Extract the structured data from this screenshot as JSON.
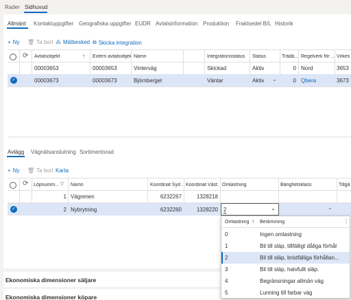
{
  "top_tabs": [
    "Rader",
    "Sidhuvud"
  ],
  "sub_tabs": [
    "Allmänt",
    "Kontaktuppgifter",
    "Geografiska uppgifter",
    "EUDR",
    "Avtalsinformation",
    "Produktion",
    "Fraktsedel B/L",
    "Historik"
  ],
  "toolbar1": {
    "new": "Ny",
    "delete": "Ta bort",
    "measure": "Mätbesked",
    "send": "Skicka integration"
  },
  "grid1": {
    "headers": [
      "Avtalsobjekt",
      "Extern avtalsobjek...",
      "Namn",
      "Integrationsstatus",
      "Status",
      "Trädä...",
      "Regelverk för ...",
      "Virkes"
    ],
    "rows": [
      {
        "obj": "00003653",
        "ext": "00003653",
        "name": "Vinterväg",
        "integ": "Skickad",
        "status": "Aktiv",
        "trad": "0",
        "regel": "Nord",
        "virkes": "3653"
      },
      {
        "obj": "00003673",
        "ext": "00003673",
        "name": "Björnberget",
        "integ": "Väntar",
        "status": "Aktiv",
        "trad": "0",
        "regel": "Qbera",
        "virkes": "3673"
      }
    ]
  },
  "bottom_tabs": [
    "Avlägg",
    "Vägnätsanslutning",
    "Sortimentsrad"
  ],
  "toolbar2": {
    "new": "Ny",
    "delete": "Ta bort",
    "map": "Karta"
  },
  "grid2": {
    "headers": [
      "Löpnumm...",
      "Namn",
      "Koordinat Syd ...",
      "Koordinat Väst...",
      "Omlastning",
      "Bärighetsklass",
      "Tillgä"
    ],
    "rows": [
      {
        "num": "1",
        "name": "Vägrenen",
        "syd": "6232267",
        "vast": "1328218",
        "oml": ""
      },
      {
        "num": "2",
        "name": "Nybrytning",
        "syd": "6232260",
        "vast": "1328220",
        "oml": "2"
      }
    ]
  },
  "dropdown": {
    "headers": [
      "Omlastning",
      "Beskrivning"
    ],
    "items": [
      {
        "code": "0",
        "desc": "Ingen omlastning"
      },
      {
        "code": "1",
        "desc": "Bil till släp, tillfälligt dåliga förhål"
      },
      {
        "code": "2",
        "desc": "Bil till släp, bristfälliga förhållan..."
      },
      {
        "code": "3",
        "desc": "Bil till släp, halvfullt släp."
      },
      {
        "code": "4",
        "desc": "Begränsningar allmän väg"
      },
      {
        "code": "5",
        "desc": "Lunning till farbar väg"
      }
    ]
  },
  "sections": [
    "Ekonomiska dimensioner säljare",
    "Ekonomiska dimensioner köpare"
  ],
  "colors": {
    "accent": "#0f6cbd",
    "selected_row": "#dde6f7"
  }
}
